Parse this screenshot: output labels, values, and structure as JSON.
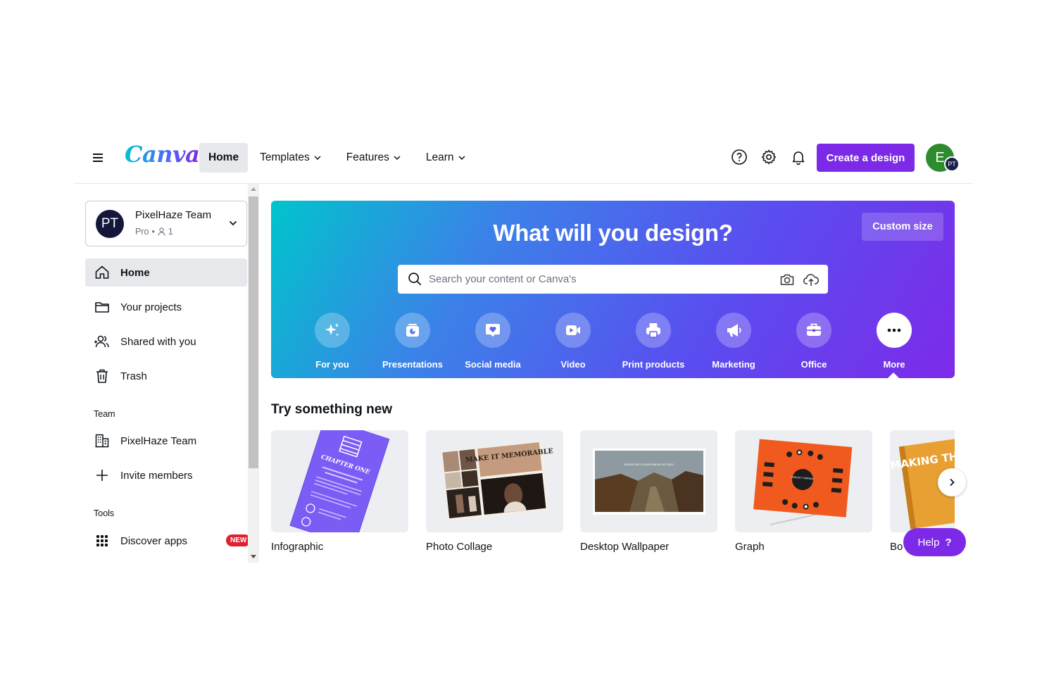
{
  "topbar": {
    "logo": "Canva",
    "nav": [
      {
        "label": "Home"
      },
      {
        "label": "Templates"
      },
      {
        "label": "Features"
      },
      {
        "label": "Learn"
      }
    ],
    "create_label": "Create a design",
    "avatar_initial": "E",
    "avatar_badge": "PT"
  },
  "sidebar": {
    "team": {
      "initials": "PT",
      "name": "PixelHaze Team",
      "plan": "Pro",
      "members": "1"
    },
    "items": [
      {
        "label": "Home",
        "icon": "home-icon"
      },
      {
        "label": "Your projects",
        "icon": "folder-icon"
      },
      {
        "label": "Shared with you",
        "icon": "shared-users-icon"
      },
      {
        "label": "Trash",
        "icon": "trash-icon"
      }
    ],
    "team_heading": "Team",
    "team_items": [
      {
        "label": "PixelHaze Team",
        "icon": "building-icon"
      },
      {
        "label": "Invite members",
        "icon": "plus-icon"
      }
    ],
    "tools_heading": "Tools",
    "tools_items": [
      {
        "label": "Discover apps",
        "icon": "apps-grid-icon",
        "badge": "NEW"
      }
    ]
  },
  "hero": {
    "title": "What will you design?",
    "custom_size": "Custom size",
    "search_placeholder": "Search your content or Canva's",
    "categories": [
      {
        "label": "For you",
        "icon": "sparkle-icon"
      },
      {
        "label": "Presentations",
        "icon": "presentation-icon"
      },
      {
        "label": "Social media",
        "icon": "heart-chat-icon"
      },
      {
        "label": "Video",
        "icon": "video-icon"
      },
      {
        "label": "Print products",
        "icon": "printer-icon"
      },
      {
        "label": "Marketing",
        "icon": "megaphone-icon"
      },
      {
        "label": "Office",
        "icon": "briefcase-icon"
      },
      {
        "label": "More",
        "icon": "more-dots-icon"
      }
    ]
  },
  "try_new": {
    "title": "Try something new",
    "cards": [
      {
        "label": "Infographic",
        "thumb_text": "CHAPTER ONE"
      },
      {
        "label": "Photo Collage",
        "thumb_text": "MAKE IT MEMORABLE"
      },
      {
        "label": "Desktop Wallpaper",
        "thumb_text": "ADVENTURE IS WORTHWHILE IN ITSELF."
      },
      {
        "label": "Graph",
        "thumb_text": "INSIGHT COMPANY"
      },
      {
        "label": "Bo",
        "thumb_text": "MAKING TH HAI"
      }
    ]
  },
  "help": {
    "label": "Help",
    "symbol": "?"
  },
  "colors": {
    "brand_purple": "#7d2ae8",
    "brand_teal": "#00c4cc",
    "badge_red": "#e0202f"
  }
}
